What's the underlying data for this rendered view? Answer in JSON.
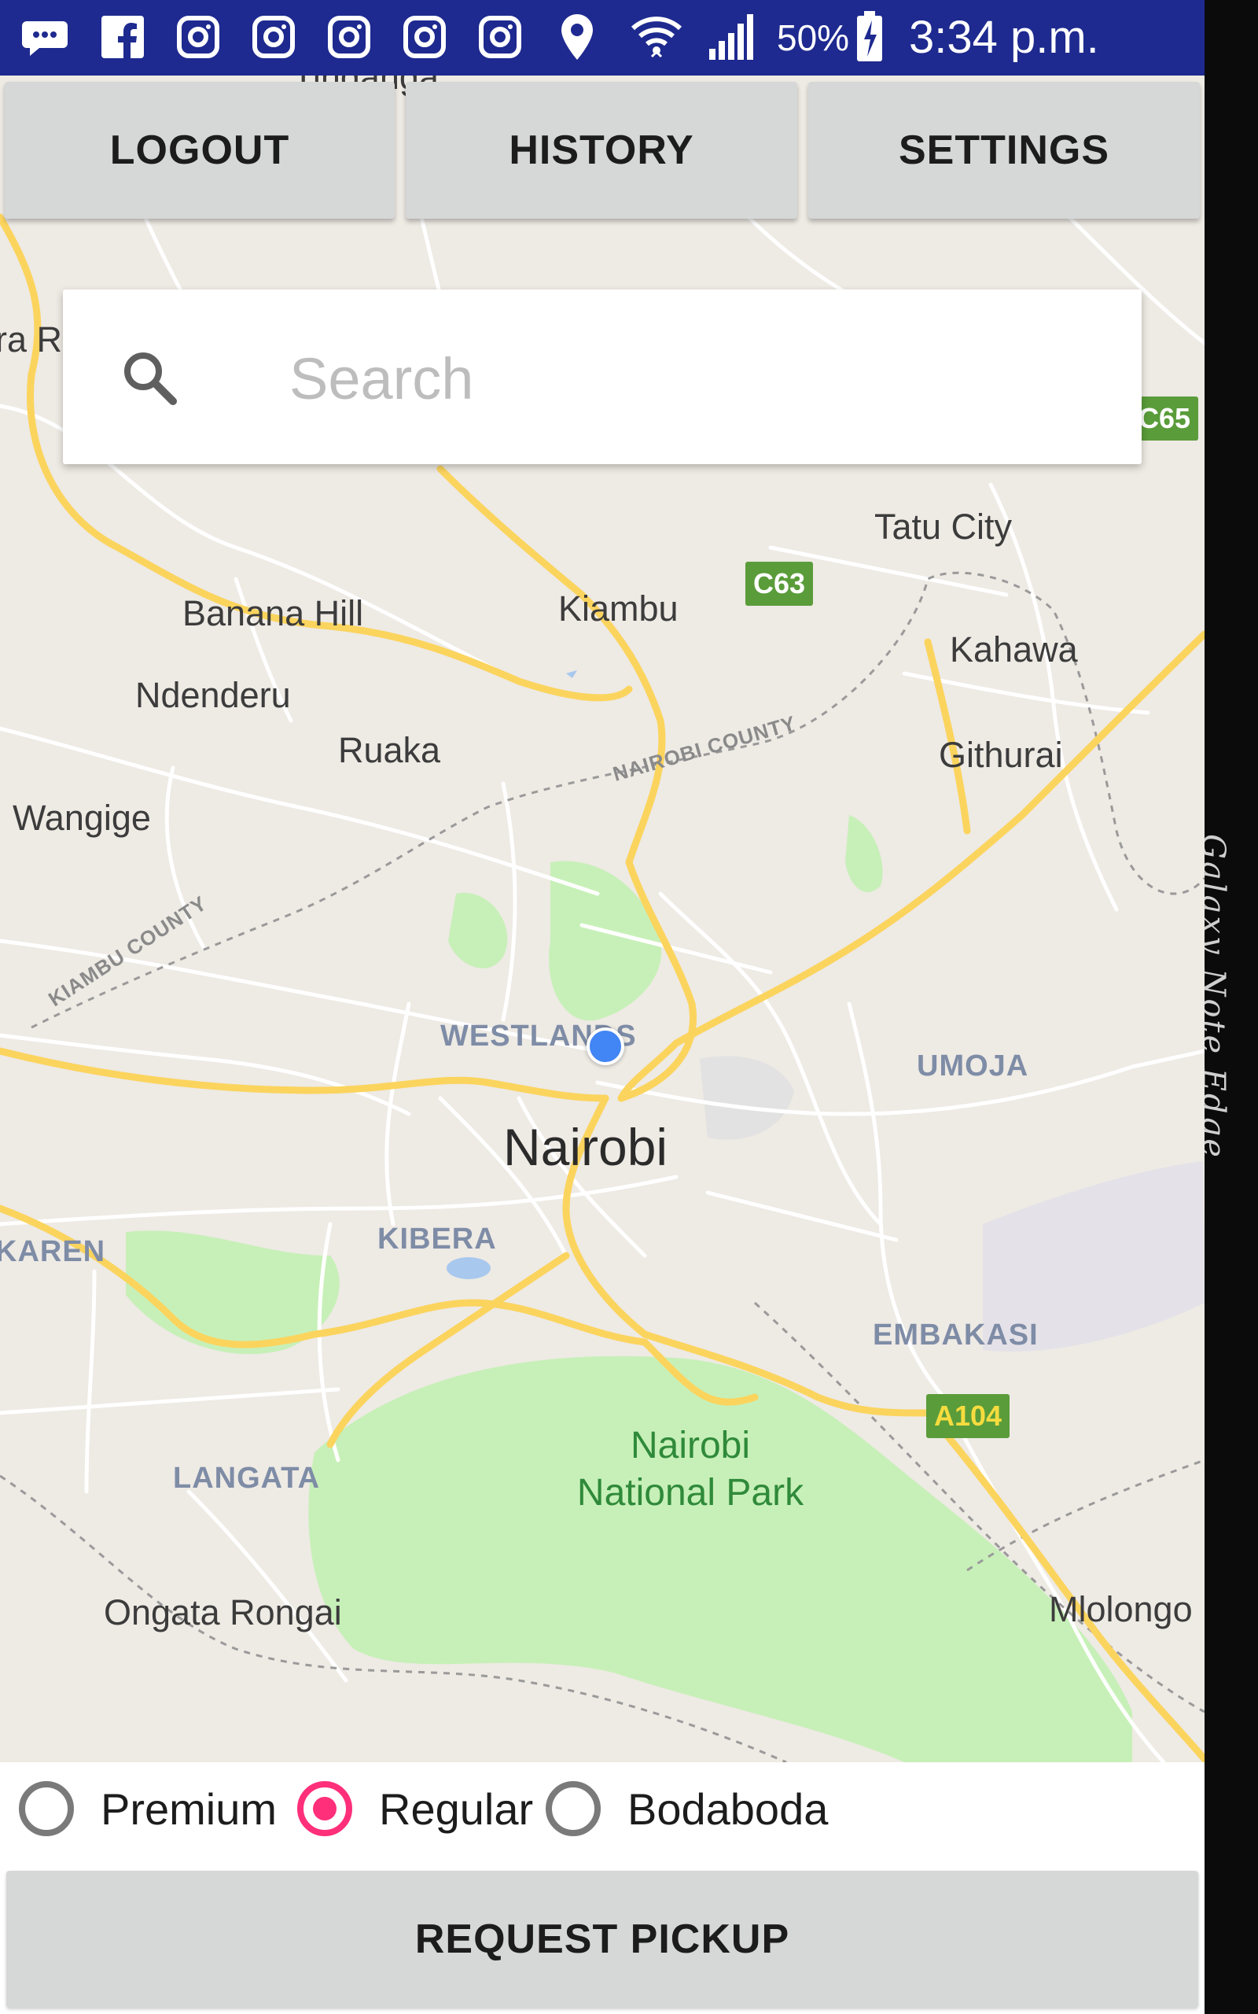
{
  "status_bar": {
    "battery": "50%",
    "time": "3:34 p.m.",
    "background": "#1e2a8f",
    "icons": [
      "messages-icon",
      "facebook-icon",
      "instagram-icon",
      "instagram-icon",
      "instagram-icon",
      "instagram-icon",
      "instagram-icon",
      "location-icon",
      "wifi-icon",
      "signal-icon",
      "battery-charging-icon"
    ]
  },
  "device": {
    "edge_label": "Galaxy Note Edge"
  },
  "toolbar": {
    "logout": "LOGOUT",
    "history": "HISTORY",
    "settings": "SETTINGS"
  },
  "search": {
    "placeholder": "Search",
    "icon": "search-icon"
  },
  "map": {
    "places": {
      "tatu_city": "Tatu City",
      "banana_hill": "Banana Hill",
      "kiambu": "Kiambu",
      "kahawa": "Kahawa",
      "ndenderu": "Ndenderu",
      "ruaka": "Ruaka",
      "githurai": "Githurai",
      "wangige": "Wangige",
      "mlolongo": "Mlolongo",
      "ongata_rongai": "Ongata Rongai",
      "nairobi": "Nairobi",
      "park": "Nairobi National Park",
      "park_line1": "Nairobi",
      "park_line2": "National Park",
      "top_cut": "Tinganga",
      "left_cut": "ra R"
    },
    "districts": {
      "westlands": "WESTLANDS",
      "umoja": "UMOJA",
      "karen": "KAREN",
      "kibera": "KIBERA",
      "embakasi": "EMBAKASI",
      "langata": "LANGATA"
    },
    "counties": {
      "nairobi_county": "NAIROBI COUNTY",
      "kiambu_county": "KIAMBU COUNTY"
    },
    "route_shields": {
      "c65": "C65",
      "c63": "C63",
      "a104": "A104"
    },
    "colors": {
      "land": "#eeeae4",
      "park": "#c7f0b8",
      "road_major": "#fbd45e",
      "road_minor": "#ffffff",
      "my_location": "#4285f4"
    }
  },
  "ride_types": {
    "options": [
      "Premium",
      "Regular",
      "Bodaboda"
    ],
    "selected": "Regular",
    "accent": "#ff2f7a"
  },
  "request_button": "REQUEST PICKUP"
}
